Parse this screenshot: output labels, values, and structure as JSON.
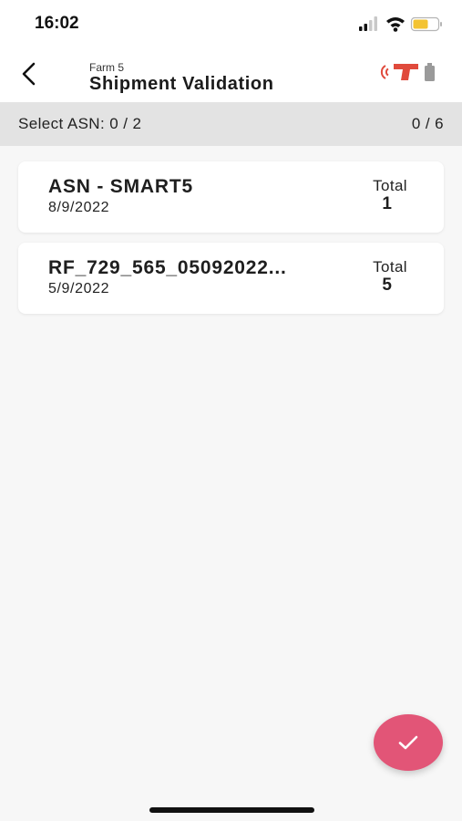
{
  "status_bar": {
    "time": "16:02",
    "icons": [
      "cellular-signal-icon",
      "wifi-icon",
      "battery-icon"
    ]
  },
  "header": {
    "subtitle": "Farm 5",
    "title": "Shipment Validation",
    "icons": [
      "back-arrow-icon",
      "rfid-scanner-icon",
      "device-battery-icon"
    ],
    "scanner_color": "#e04a3c"
  },
  "select_bar": {
    "label": "Select ASN: 0 / 2",
    "count": "0 / 6"
  },
  "asn_list": [
    {
      "title": "ASN - SMART5",
      "date": "8/9/2022",
      "total_label": "Total",
      "total_value": "1"
    },
    {
      "title": "RF_729_565_05092022...",
      "date": "5/9/2022",
      "total_label": "Total",
      "total_value": "5"
    }
  ],
  "fab": {
    "icon": "checkmark-icon",
    "color": "#e25577"
  }
}
